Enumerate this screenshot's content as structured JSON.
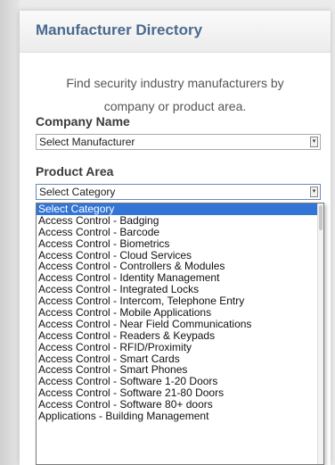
{
  "panel": {
    "title": "Manufacturer Directory",
    "intro_line1": "Find security industry manufacturers by",
    "intro_line2": "company or product area."
  },
  "company": {
    "label": "Company Name",
    "selected": "Select Manufacturer"
  },
  "product": {
    "label": "Product Area",
    "selected": "Select Category",
    "options": [
      "Select Category",
      "Access Control - Badging",
      "Access Control - Barcode",
      "Access Control - Biometrics",
      "Access Control - Cloud Services",
      "Access Control - Controllers & Modules",
      "Access Control - Identity Management",
      "Access Control - Integrated Locks",
      "Access Control - Intercom, Telephone Entry",
      "Access Control - Mobile Applications",
      "Access Control - Near Field Communications",
      "Access Control - Readers & Keypads",
      "Access Control - RFID/Proximity",
      "Access Control - Smart Cards",
      "Access Control - Smart Phones",
      "Access Control - Software 1-20 Doors",
      "Access Control - Software 21-80 Doors",
      "Access Control - Software 80+ doors",
      "Applications - Building Management"
    ]
  },
  "icons": {
    "select_arrow": "chevron-down-icon"
  }
}
